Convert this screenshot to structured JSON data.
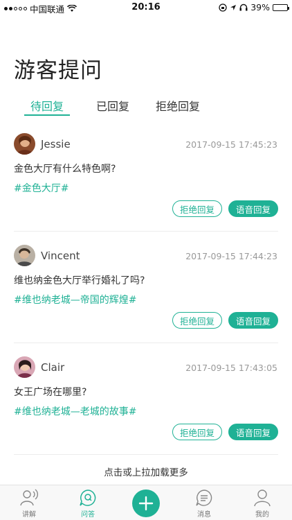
{
  "status_bar": {
    "carrier": "中国联通",
    "time": "20:16",
    "battery": "39%",
    "battery_level": 0.39
  },
  "header": {
    "title": "游客提问"
  },
  "tabs": [
    {
      "label": "待回复",
      "active": true
    },
    {
      "label": "已回复",
      "active": false
    },
    {
      "label": "拒绝回复",
      "active": false
    }
  ],
  "questions": [
    {
      "user": "Jessie",
      "time": "2017-09-15 17:45:23",
      "question": "金色大厅有什么特色啊?",
      "tag": "#金色大厅#",
      "reject_label": "拒绝回复",
      "voice_label": "语音回复"
    },
    {
      "user": "Vincent",
      "time": "2017-09-15 17:44:23",
      "question": "维也纳金色大厅举行婚礼了吗?",
      "tag": "#维也纳老城—帝国的辉煌#",
      "reject_label": "拒绝回复",
      "voice_label": "语音回复"
    },
    {
      "user": "Clair",
      "time": "2017-09-15 17:43:05",
      "question": "女王广场在哪里?",
      "tag": "#维也纳老城—老城的故事#",
      "reject_label": "拒绝回复",
      "voice_label": "语音回复"
    }
  ],
  "load_more": "点击或上拉加载更多",
  "tab_bar": {
    "items": [
      {
        "label": "讲解",
        "icon": "speaker-person-icon"
      },
      {
        "label": "问答",
        "icon": "qa-bubble-icon",
        "active": true
      },
      {
        "label": "",
        "icon": "plus-icon"
      },
      {
        "label": "消息",
        "icon": "message-icon"
      },
      {
        "label": "我的",
        "icon": "profile-icon"
      }
    ]
  },
  "colors": {
    "accent": "#1fb195"
  }
}
